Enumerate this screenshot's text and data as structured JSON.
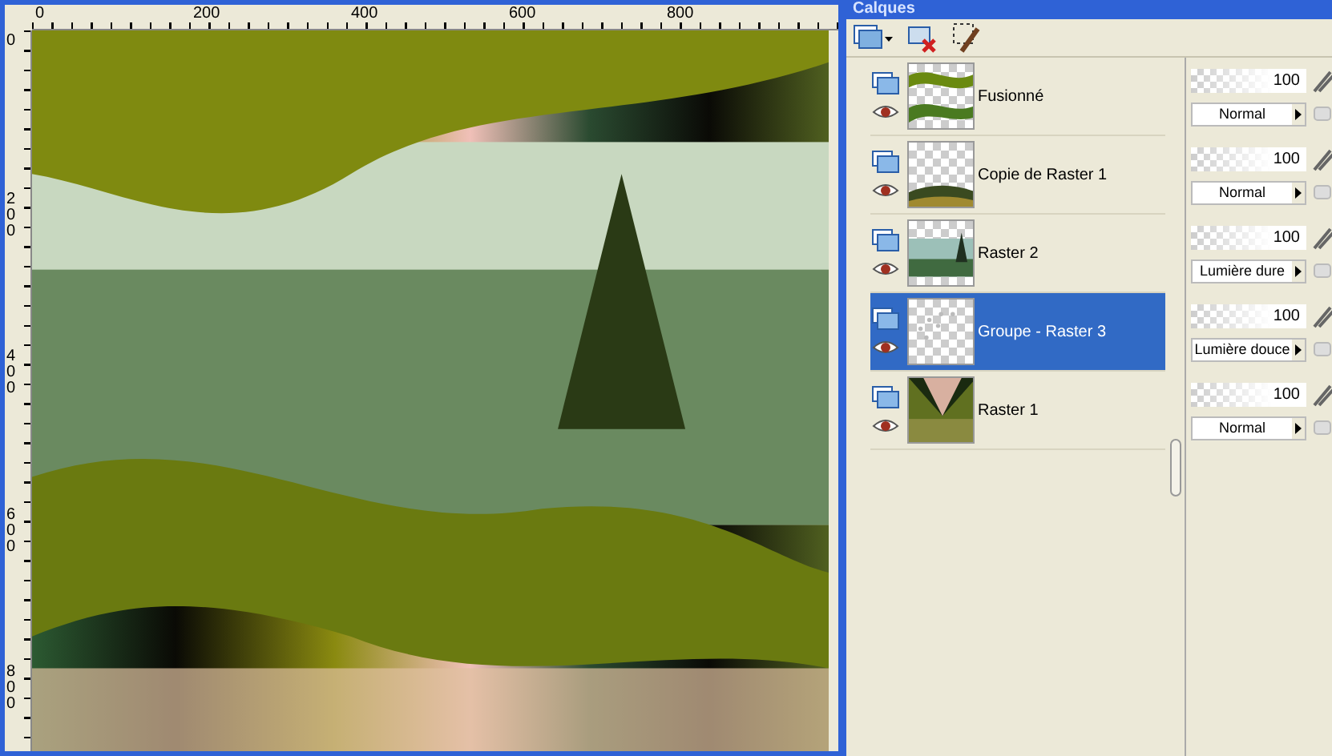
{
  "palette": {
    "title": "Calques"
  },
  "rulers": {
    "horizontal": [
      "0",
      "200",
      "400",
      "600",
      "800"
    ],
    "vertical": [
      "0",
      "200",
      "400",
      "600",
      "800"
    ]
  },
  "layers": [
    {
      "name": "Fusionné",
      "kind": "waves",
      "selected": false,
      "opacity": "100",
      "level": 1,
      "blend_mode": "Normal"
    },
    {
      "name": "Copie de Raster 1",
      "kind": "arc",
      "selected": false,
      "opacity": "100",
      "level": 1,
      "blend_mode": "Normal"
    },
    {
      "name": "Raster 2",
      "kind": "landscape",
      "selected": false,
      "opacity": "100",
      "level": 1,
      "blend_mode": "Lumière dure"
    },
    {
      "name": "Groupe - Raster 3",
      "kind": "dots",
      "selected": true,
      "opacity": "100",
      "level": 1,
      "blend_mode": "Lumière douce"
    },
    {
      "name": "Raster 1",
      "kind": "gradient",
      "selected": false,
      "opacity": "100",
      "level": 1,
      "blend_mode": "Normal"
    }
  ]
}
